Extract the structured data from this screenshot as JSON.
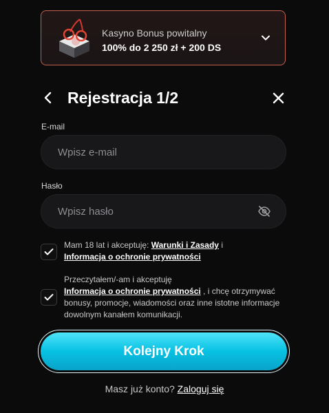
{
  "bonus": {
    "title": "Kasyno Bonus powitalny",
    "value": "100% do 2 250 zł + 200 DS",
    "image": "gift-box-with-cherries",
    "accent_color": "#c4614f"
  },
  "header": {
    "title": "Rejestracja 1/2"
  },
  "form": {
    "email_label": "E-mail",
    "email_placeholder": "Wpisz e-mail",
    "email_value": "",
    "password_label": "Hasło",
    "password_placeholder": "Wpisz hasło",
    "password_value": ""
  },
  "consents": [
    {
      "checked": true,
      "prefix": "Mam 18 lat i akceptuję: ",
      "link1": "Warunki i Zasady",
      "mid": " i",
      "link2": "Informacja o ochronie prywatności"
    },
    {
      "checked": true,
      "prefix": "Przeczytałem/-am i akceptuję",
      "link": "Informacja o ochronie prywatności",
      "suffix": " , i chcę otrzymywać bonusy, promocje, wiadomości oraz inne istotne informacje dowolnym kanałem komunikacji."
    }
  ],
  "cta": {
    "label": "Kolejny Krok",
    "color": "#07c1e3"
  },
  "login": {
    "prompt": "Masz już konto?",
    "link": "Zaloguj się"
  }
}
